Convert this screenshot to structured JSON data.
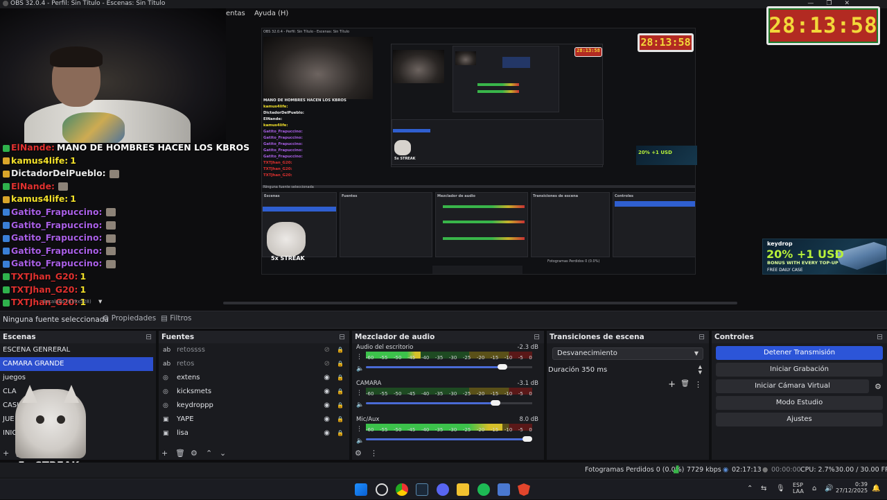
{
  "window": {
    "title": "OBS 32.0.4 - Perfil: Sin Título - Escenas: Sin Título"
  },
  "menu": {
    "items": [
      "entas",
      "Ayuda (H)"
    ]
  },
  "clock": {
    "time": "28:13:58"
  },
  "ad": {
    "brand": "keydrop",
    "headline": "20% +1 USD",
    "subline": "BONUS WITH EVERY TOP-UP",
    "case": "FREE DAILY CASE"
  },
  "chat": [
    {
      "user": "ElNande:",
      "msg": "MANO DE HOMBRES HACEN LOS KBROS",
      "color": "#e0312f",
      "msg_color": "#ffffff"
    },
    {
      "user": "kamus4life:",
      "msg": "1",
      "color": "#f2e02a",
      "msg_color": "#f2e02a"
    },
    {
      "user": "DictadorDelPueblo:",
      "msg": "",
      "color": "#e9e9e9",
      "msg_color": "#e9e9e9"
    },
    {
      "user": "ElNande:",
      "msg": "",
      "color": "#e0312f",
      "msg_color": "#e0312f"
    },
    {
      "user": "kamus4life:",
      "msg": "1",
      "color": "#f2e02a",
      "msg_color": "#f2e02a"
    },
    {
      "user": "Gatito_Frapuccino:",
      "msg": "",
      "color": "#a95fe6",
      "msg_color": "#a95fe6"
    },
    {
      "user": "Gatito_Frapuccino:",
      "msg": "",
      "color": "#a95fe6",
      "msg_color": "#a95fe6"
    },
    {
      "user": "Gatito_Frapuccino:",
      "msg": "",
      "color": "#a95fe6",
      "msg_color": "#a95fe6"
    },
    {
      "user": "Gatito_Frapuccino:",
      "msg": "",
      "color": "#a95fe6",
      "msg_color": "#a95fe6"
    },
    {
      "user": "Gatito_Frapuccino:",
      "msg": "",
      "color": "#a95fe6",
      "msg_color": "#a95fe6"
    },
    {
      "user": "TXTJhan_G20:",
      "msg": "1",
      "color": "#e0312f",
      "msg_color": "#f2e02a"
    },
    {
      "user": "TXTJhan_G20:",
      "msg": "1",
      "color": "#e0312f",
      "msg_color": "#f2e02a"
    },
    {
      "user": "TXTJhan_G20:",
      "msg": "1",
      "color": "#e0312f",
      "msg_color": "#f2e02a"
    }
  ],
  "preview": {
    "scale_label": "Escalado (839x528)",
    "streak": "5x STREAK",
    "chat_mini": [
      "MANO DE HOMBRES HACEN LOS KBROS",
      "kamus4life:",
      "DictadorDelPueblo:",
      "ElNande:",
      "kamus4life:",
      "Gatito_Frapuccino:",
      "Gatito_Frapuccino:",
      "Gatito_Frapuccino:",
      "Gatito_Frapuccino:",
      "Gatito_Frapuccino:",
      "TXTJhan_G20:",
      "TXTJhan_G20:",
      "TXTJhan_G20:"
    ]
  },
  "source_bar": {
    "no_source": "Ninguna fuente seleccionada",
    "properties": "Propiedades",
    "filters": "Filtros"
  },
  "scenes": {
    "title": "Escenas",
    "items": [
      "ESCENA GENRERAL",
      "CAMARA GRANDE",
      "juegos",
      "CLA",
      "CASI",
      "JUE",
      "INIC"
    ],
    "selected": 1
  },
  "sources": {
    "title": "Fuentes",
    "items": [
      {
        "name": "retossss",
        "icon": "text-icon",
        "hidden": true
      },
      {
        "name": "retos",
        "icon": "text-icon",
        "hidden": true
      },
      {
        "name": "extens",
        "icon": "browser-icon",
        "hidden": false
      },
      {
        "name": "kicksmets",
        "icon": "browser-icon",
        "hidden": false
      },
      {
        "name": "keydroppp",
        "icon": "browser-icon",
        "hidden": false
      },
      {
        "name": "YAPE",
        "icon": "image-icon",
        "hidden": false
      },
      {
        "name": "lisa",
        "icon": "image-icon",
        "hidden": false
      }
    ]
  },
  "mixer": {
    "title": "Mezclador de audio",
    "scale": [
      "-60",
      "-55",
      "-50",
      "-45",
      "-40",
      "-35",
      "-30",
      "-25",
      "-20",
      "-15",
      "-10",
      "-5",
      "0"
    ],
    "channels": [
      {
        "name": "Audio del escritorio",
        "db": "-2.3 dB",
        "level": 0.33,
        "volume": 0.82
      },
      {
        "name": "CAMARA",
        "db": "-3.1 dB",
        "level": 0,
        "volume": 0.78
      },
      {
        "name": "Mic/Aux",
        "db": "8.0 dB",
        "level": 0.82,
        "volume": 0.97
      }
    ]
  },
  "transitions": {
    "title": "Transiciones de escena",
    "selected": "Desvanecimiento",
    "duration_label": "Duración",
    "duration_value": "350 ms"
  },
  "controls": {
    "title": "Controles",
    "stop_stream": "Detener Transmisión",
    "start_recording": "Iniciar Grabación",
    "start_virtual_cam": "Iniciar Cámara Virtual",
    "studio_mode": "Modo Estudio",
    "settings": "Ajustes"
  },
  "status": {
    "dropped_frames": "Fotogramas Perdidos 0 (0.0%)",
    "bitrate": "7729 kbps",
    "stream_time": "02:17:13",
    "rec_time": "00:00:00",
    "cpu": "CPU: 2.7%",
    "fps": "30.00 / 30.00 FPS"
  },
  "taskbar": {
    "lang": "ESP",
    "lang2": "LAA",
    "time": "0:39",
    "date": "27/12/2025"
  }
}
